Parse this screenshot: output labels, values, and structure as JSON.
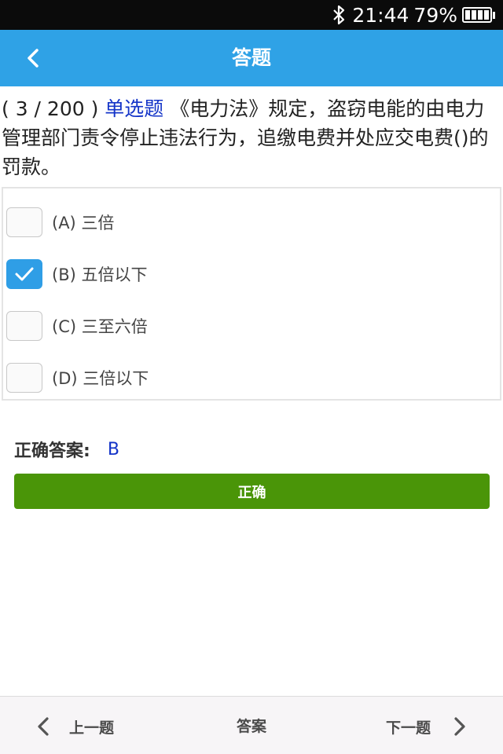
{
  "status_bar": {
    "time": "21:44",
    "battery": "79%",
    "icons": [
      "bluetooth-icon",
      "battery-icon"
    ]
  },
  "header": {
    "title": "答题",
    "back_icon": "chevron-left-icon"
  },
  "question": {
    "counter": "( 3 / 200 )",
    "type": "单选题",
    "text": "《电力法》规定，盗窃电能的由电力管理部门责令停止违法行为，追缴电费并处应交电费()的罚款。"
  },
  "options": [
    {
      "label": "(A) 三倍",
      "checked": false
    },
    {
      "label": "(B) 五倍以下",
      "checked": true
    },
    {
      "label": "(C) 三至六倍",
      "checked": false
    },
    {
      "label": "(D) 三倍以下",
      "checked": false
    }
  ],
  "answer": {
    "label": "正确答案:",
    "value": "B"
  },
  "result_button": {
    "label": "正确",
    "color": "#4a9508"
  },
  "bottom_nav": {
    "prev_label": "上一题",
    "answer_label": "答案",
    "next_label": "下一题"
  },
  "colors": {
    "header": "#2fa2e6",
    "question_type": "#1434c8",
    "checkbox_checked": "#2f9ee6"
  }
}
